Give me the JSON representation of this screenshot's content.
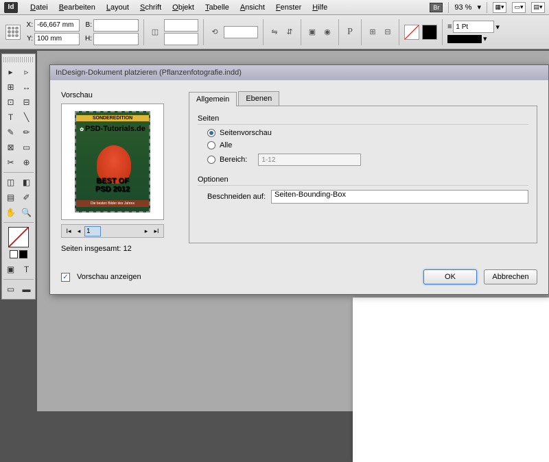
{
  "menubar": {
    "items": [
      "Datei",
      "Bearbeiten",
      "Layout",
      "Schrift",
      "Objekt",
      "Tabelle",
      "Ansicht",
      "Fenster",
      "Hilfe"
    ],
    "br": "Br",
    "zoom": "93 %"
  },
  "controls": {
    "x_label": "X:",
    "x_value": "-66,667 mm",
    "y_label": "Y:",
    "y_value": "100 mm",
    "w_label": "B:",
    "w_value": "",
    "h_label": "H:",
    "h_value": "",
    "pt_value": "1 Pt"
  },
  "dialog": {
    "title": "InDesign-Dokument platzieren (Pflanzenfotografie.indd)",
    "preview_label": "Vorschau",
    "preview_img": {
      "top_band": "SONDEREDITION",
      "logo": "PSD-Tutorials.de",
      "title1": "BEST OF",
      "title2": "PSD 2012",
      "sub": "Die besten Bilder des Jahres"
    },
    "pager": {
      "current": "1"
    },
    "total_label": "Seiten insgesamt: 12",
    "tabs": {
      "general": "Allgemein",
      "layers": "Ebenen"
    },
    "pages": {
      "legend": "Seiten",
      "opt_preview": "Seitenvorschau",
      "opt_all": "Alle",
      "opt_range": "Bereich:",
      "range_value": "1-12"
    },
    "options": {
      "legend": "Optionen",
      "crop_label": "Beschneiden auf:",
      "crop_value": "Seiten-Bounding-Box"
    },
    "show_preview": "Vorschau anzeigen",
    "ok": "OK",
    "cancel": "Abbrechen"
  }
}
